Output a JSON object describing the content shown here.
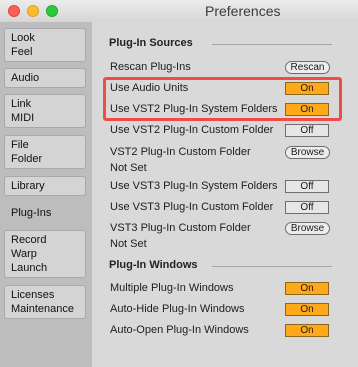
{
  "window": {
    "title": "Preferences"
  },
  "sidebar": {
    "tabs": [
      {
        "lines": [
          "Look",
          "Feel"
        ]
      },
      {
        "lines": [
          "Audio"
        ]
      },
      {
        "lines": [
          "Link",
          "MIDI"
        ]
      },
      {
        "lines": [
          "File",
          "Folder"
        ]
      },
      {
        "lines": [
          "Library"
        ]
      },
      {
        "lines": [
          "Plug-Ins"
        ],
        "active": true
      },
      {
        "lines": [
          "Record",
          "Warp",
          "Launch"
        ]
      },
      {
        "lines": [
          "Licenses",
          "Maintenance"
        ]
      }
    ]
  },
  "plugin_sources": {
    "title": "Plug-In Sources",
    "rescan": {
      "label": "Rescan Plug-Ins",
      "button": "Rescan"
    },
    "use_audio_units": {
      "label": "Use Audio Units",
      "value": "On"
    },
    "use_vst2_system": {
      "label": "Use VST2 Plug-In System Folders",
      "value": "On"
    },
    "use_vst2_custom": {
      "label": "Use VST2 Plug-In Custom Folder",
      "value": "Off"
    },
    "vst2_custom_folder": {
      "label": "VST2 Plug-In Custom Folder",
      "button": "Browse",
      "path": "Not Set"
    },
    "use_vst3_system": {
      "label": "Use VST3 Plug-In System Folders",
      "value": "Off"
    },
    "use_vst3_custom": {
      "label": "Use VST3 Plug-In Custom Folder",
      "value": "Off"
    },
    "vst3_custom_folder": {
      "label": "VST3 Plug-In Custom Folder",
      "button": "Browse",
      "path": "Not Set"
    }
  },
  "plugin_windows": {
    "title": "Plug-In Windows",
    "multiple": {
      "label": "Multiple Plug-In Windows",
      "value": "On"
    },
    "auto_hide": {
      "label": "Auto-Hide Plug-In Windows",
      "value": "On"
    },
    "auto_open": {
      "label": "Auto-Open Plug-In Windows",
      "value": "On"
    }
  },
  "colors": {
    "toggle_on": "#ffa91a",
    "highlight": "#f14b47"
  }
}
